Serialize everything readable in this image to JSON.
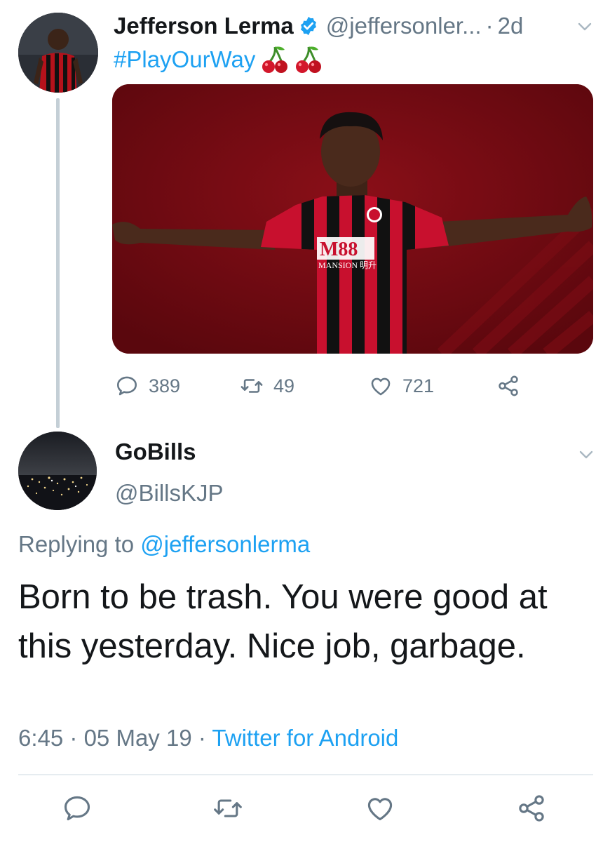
{
  "parent_tweet": {
    "display_name": "Jefferson Lerma",
    "handle": "@jeffersonler...",
    "separator": "·",
    "age": "2d",
    "hashtag": "#PlayOurWay",
    "emoji_icons": [
      "cherries-emoji",
      "cherries-emoji"
    ],
    "media": {
      "shirt_sponsor_logo": "M88",
      "shirt_sponsor_name": "MANSION 明升"
    },
    "stats": {
      "replies": "389",
      "retweets": "49",
      "likes": "721"
    }
  },
  "reply_tweet": {
    "display_name": "GoBills",
    "handle": "@BillsKJP",
    "replying_prefix": "Replying to",
    "replying_mention": "@jeffersonlerma",
    "text": "Born to be trash. You were good at this yesterday. Nice job, garbage.",
    "time": "6:45",
    "date": "05 May 19",
    "separator": "·",
    "source": "Twitter for Android"
  },
  "colors": {
    "link": "#1da1f2",
    "muted": "#657786",
    "text": "#14171a",
    "verified": "#1da1f2",
    "kit_red": "#c8102e"
  }
}
